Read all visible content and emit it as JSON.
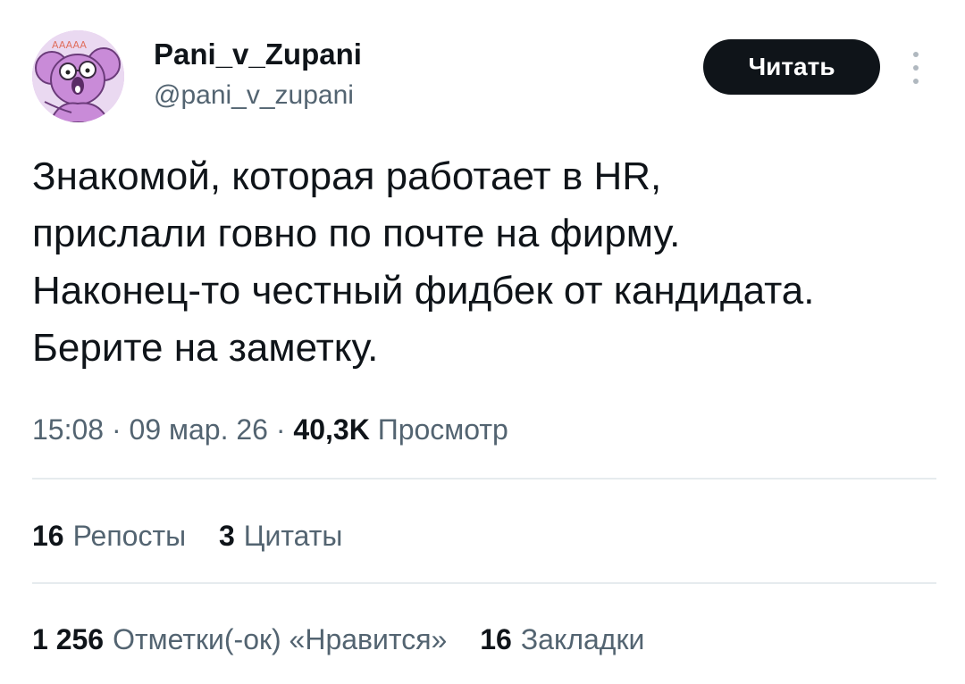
{
  "author": {
    "display_name": "Pani_v_Zupani",
    "handle": "@pani_v_zupani",
    "avatar_icon": "koala-cartoon-avatar"
  },
  "actions": {
    "follow_label": "Читать",
    "more_icon": "vertical-ellipsis-icon"
  },
  "tweet": {
    "lines": [
      "Знакомой, которая работает в HR,",
      "прислали говно по почте на фирму.",
      "Наконец-то честный фидбек от кандидата.",
      "Берите на заметку."
    ]
  },
  "meta": {
    "time": "15:08",
    "separator": "·",
    "date": "09 мар. 26",
    "views_count": "40,3K",
    "views_label": "Просмотр"
  },
  "stats": {
    "reposts_count": "16",
    "reposts_label": "Репосты",
    "quotes_count": "3",
    "quotes_label": "Цитаты",
    "likes_count": "1 256",
    "likes_label": "Отметки(-ок) «Нравится»",
    "bookmarks_count": "16",
    "bookmarks_label": "Закладки"
  },
  "colors": {
    "text_primary": "#0f1419",
    "text_secondary": "#536471",
    "divider": "#e6ebee",
    "button_bg": "#0f1419",
    "avatar_bg": "#d9a9e8"
  }
}
